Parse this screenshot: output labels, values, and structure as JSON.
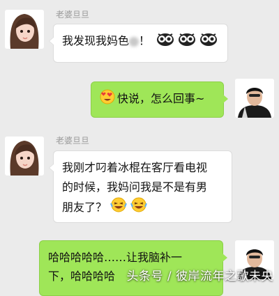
{
  "messages": [
    {
      "sender": "老婆旦旦",
      "text_before": "我发现我妈色",
      "text_after": "！",
      "emoji": [
        "owl",
        "owl",
        "owl"
      ]
    },
    {
      "text": "快说，怎么回事~",
      "emoji_prefix": "heart-eyes"
    },
    {
      "sender": "老婆旦旦",
      "lines": [
        "我刚才叼着冰棍在客厅看电视",
        "的时候，我妈问我是不是有男",
        "朋友了？"
      ],
      "emoji": [
        "laugh",
        "laugh"
      ]
    },
    {
      "lines": [
        "哈哈哈哈哈……让我脑补一",
        "下，哈哈哈哈"
      ]
    }
  ],
  "watermark": "头条号 / 彼岸流年之歌未央"
}
